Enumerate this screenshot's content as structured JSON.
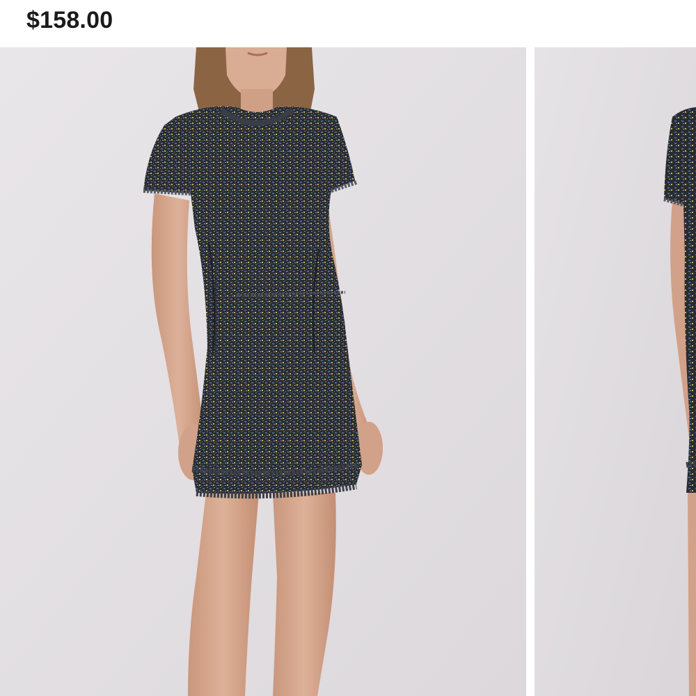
{
  "product": {
    "price": "$158.00"
  },
  "gallery": {
    "images": [
      {
        "alt": "tweed-dress-front"
      },
      {
        "alt": "tweed-dress-side"
      }
    ]
  },
  "colors": {
    "background": "#e6e3e6",
    "dress": "#2a2c33",
    "skin": "#d8ab92",
    "hair": "#8b6444"
  }
}
